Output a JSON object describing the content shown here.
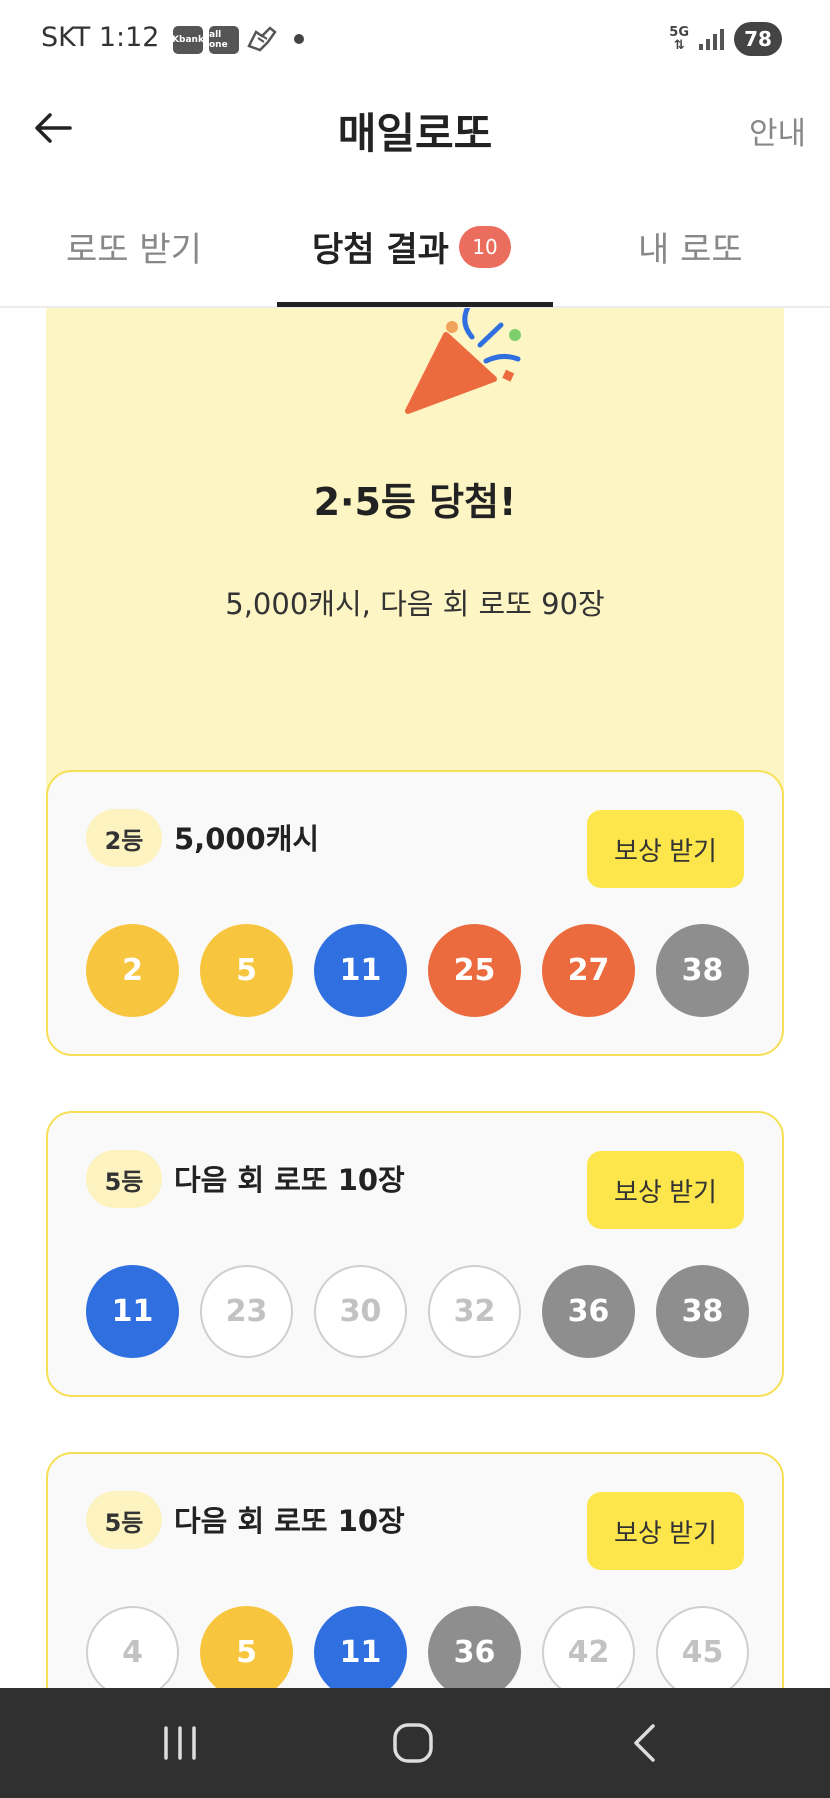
{
  "status_bar": {
    "carrier_time": "SKT 1:12",
    "app_icons": [
      "Kbank",
      "all one",
      "shoe-icon"
    ],
    "network": "5G",
    "battery": "78"
  },
  "header": {
    "title": "매일로또",
    "info_label": "안내"
  },
  "tabs": [
    {
      "label": "로또 받기"
    },
    {
      "label": "당첨 결과",
      "badge": "10",
      "active": true
    },
    {
      "label": "내 로또"
    }
  ],
  "banner": {
    "title": "2·5등 당첨!",
    "subtitle": "5,000캐시, 다음 회 로또 90장"
  },
  "prizes": [
    {
      "rank": "2등",
      "reward": "5,000캐시",
      "button_label": "보상 받기",
      "numbers": [
        {
          "value": "2",
          "color": "yellow"
        },
        {
          "value": "5",
          "color": "yellow"
        },
        {
          "value": "11",
          "color": "blue"
        },
        {
          "value": "25",
          "color": "orange"
        },
        {
          "value": "27",
          "color": "orange"
        },
        {
          "value": "38",
          "color": "gray"
        }
      ]
    },
    {
      "rank": "5등",
      "reward": "다음 회 로또 10장",
      "button_label": "보상 받기",
      "numbers": [
        {
          "value": "11",
          "color": "blue"
        },
        {
          "value": "23",
          "color": "empty"
        },
        {
          "value": "30",
          "color": "empty"
        },
        {
          "value": "32",
          "color": "empty"
        },
        {
          "value": "36",
          "color": "gray"
        },
        {
          "value": "38",
          "color": "gray"
        }
      ]
    },
    {
      "rank": "5등",
      "reward": "다음 회 로또 10장",
      "button_label": "보상 받기",
      "numbers": [
        {
          "value": "4",
          "color": "empty"
        },
        {
          "value": "5",
          "color": "yellow"
        },
        {
          "value": "11",
          "color": "blue"
        },
        {
          "value": "36",
          "color": "gray"
        },
        {
          "value": "42",
          "color": "empty"
        },
        {
          "value": "45",
          "color": "empty"
        }
      ]
    }
  ],
  "colors": {
    "yellow": "#f8c53f",
    "blue": "#2f6fe0",
    "orange": "#ec6b3e",
    "gray": "#8e8e8e",
    "accent": "#fce64b",
    "badge": "#ea6d5d"
  }
}
